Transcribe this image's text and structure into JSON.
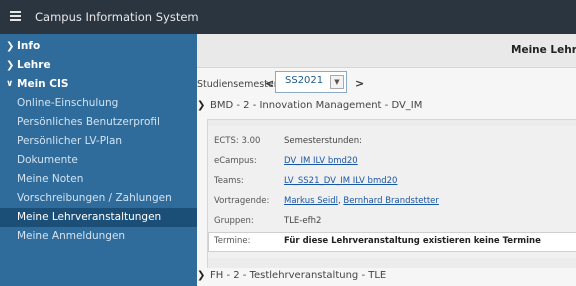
{
  "app": {
    "title": "Campus Information System"
  },
  "sidebar": {
    "items": [
      {
        "label": "Info",
        "chevron": ">"
      },
      {
        "label": "Lehre",
        "chevron": ">"
      },
      {
        "label": "Mein CIS",
        "chevron": "v"
      }
    ],
    "sub_items": [
      {
        "label": "Online-Einschulung"
      },
      {
        "label": "Persönliches Benutzerprofil"
      },
      {
        "label": "Persönlicher LV-Plan"
      },
      {
        "label": "Dokumente"
      },
      {
        "label": "Meine Noten"
      },
      {
        "label": "Vorschreibungen / Zahlungen"
      },
      {
        "label": "Meine Lehrveranstaltungen",
        "active": true
      },
      {
        "label": "Meine Anmeldungen"
      }
    ]
  },
  "main": {
    "title": "Meine Lehrver",
    "semester": {
      "label": "Studiensemester",
      "value": "SS2021",
      "prev": "<",
      "next": ">"
    },
    "courses": [
      {
        "label": "BMD - 2 - Innovation Management - DV_IM",
        "expanded": true,
        "details": {
          "ects": "ECTS: 3.00",
          "semesterstunden": "Semesterstunden:",
          "ecampus_label": "eCampus:",
          "ecampus_link": "DV_IM ILV bmd20",
          "teams_label": "Teams:",
          "teams_link": "LV_SS21_DV_IM ILV bmd20",
          "vortragende_label": "Vortragende:",
          "vortragende_1": "Markus Seidl",
          "vortragende_2": "Bernhard Brandstetter",
          "gruppen_label": "Gruppen:",
          "gruppen_value": "TLE-efh2",
          "termine_label": "Termine:",
          "termine_value": "Für diese Lehrveranstaltung existieren keine Termine"
        }
      },
      {
        "label": "FH - 2 - Testlehrveranstaltung - TLE",
        "expanded": false
      }
    ]
  },
  "colors": {
    "topbar": "#2a3540",
    "sidebar": "#2f6b9b",
    "sidebar_active": "#1c4f78",
    "link": "#1a56a6"
  }
}
